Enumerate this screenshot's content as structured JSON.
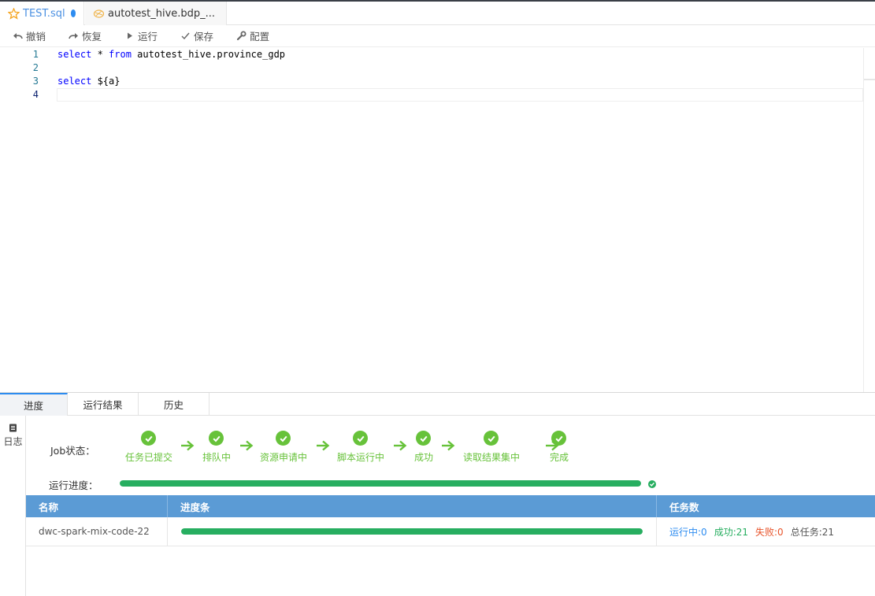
{
  "tabs": [
    {
      "label": "TEST.sql",
      "icon": "star-icon",
      "unsaved": true
    },
    {
      "label": "autotest_hive.bdp_...",
      "icon": "hive-table-icon"
    }
  ],
  "toolbar": {
    "undo": "撤销",
    "redo": "恢复",
    "run": "运行",
    "save": "保存",
    "config": "配置"
  },
  "editor": {
    "line_numbers": [
      "1",
      "2",
      "3",
      "4"
    ],
    "lines": [
      {
        "kw": "select",
        "rest": " * ",
        "kw2": "from",
        "rest2": " autotest_hive.province_gdp"
      },
      {
        "kw": "",
        "rest": "",
        "kw2": "",
        "rest2": ""
      },
      {
        "kw": "select",
        "rest": " ${a}",
        "kw2": "",
        "rest2": ""
      },
      {
        "kw": "",
        "rest": "",
        "kw2": "",
        "rest2": ""
      }
    ],
    "current_line": 4
  },
  "bottom_tabs": [
    "进度",
    "运行结果",
    "历史"
  ],
  "active_bottom_tab": "进度",
  "sidebar": {
    "log": "日志"
  },
  "job": {
    "label": "Job状态：",
    "steps": [
      "任务已提交",
      "排队中",
      "资源申请中",
      "脚本运行中",
      "成功",
      "读取结果集中",
      "完成"
    ]
  },
  "progress": {
    "label": "运行进度：",
    "fraction": 1.0
  },
  "table": {
    "headers": [
      "名称",
      "进度条",
      "任务数"
    ],
    "rows": [
      {
        "name": "dwc-spark-mix-code-22",
        "progress_fraction": 1.0,
        "running": "运行中:0",
        "success": "成功:21",
        "failed": "失败:0",
        "total": "总任务:21"
      }
    ]
  },
  "colors": {
    "accent": "#2d8cf0",
    "success": "#67c23a",
    "progress": "#27ae60",
    "table_header": "#5b9bd5",
    "running": "#2d8cf0",
    "failed": "#e8542b"
  }
}
